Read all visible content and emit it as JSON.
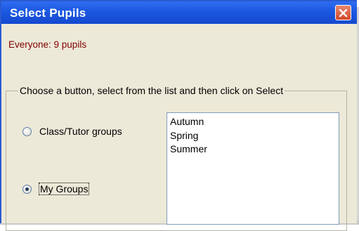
{
  "window": {
    "title": "Select Pupils",
    "close_icon": "close-icon"
  },
  "status": {
    "text": "Everyone: 9 pupils"
  },
  "group": {
    "legend": "Choose a button, select from the list and then click on Select"
  },
  "radios": [
    {
      "label": "Class/Tutor groups",
      "checked": false
    },
    {
      "label": "My Groups",
      "checked": true
    }
  ],
  "list": {
    "items": [
      "Autumn",
      "Spring",
      "Summer"
    ]
  },
  "colors": {
    "titlebar": "#1b58e0",
    "status_text": "#800000",
    "dialog_bg": "#ece9d8"
  }
}
